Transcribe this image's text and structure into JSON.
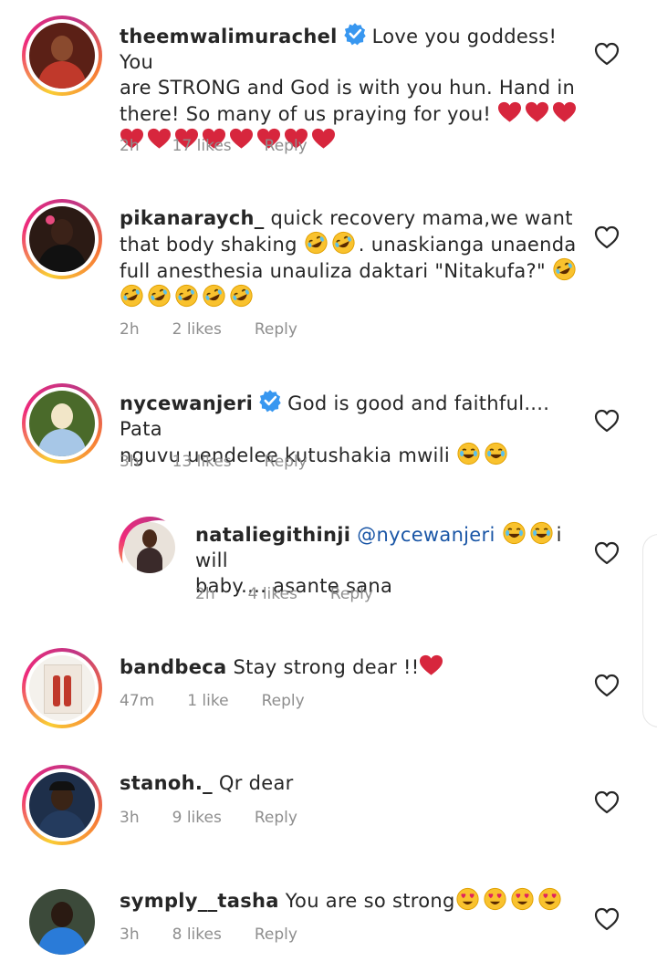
{
  "comments": [
    {
      "username": "theemwalimurachel",
      "verified": true,
      "lines": [
        "Love you goddess! You",
        "are STRONG and God is with you hun. Hand in",
        "there! So many of us praying for you!"
      ],
      "emoji_after_line3": "heart-emoji x3",
      "line4_emoji": "heart-emoji x8",
      "time": "2h",
      "likes": "17 likes",
      "reply": "Reply"
    },
    {
      "username": "pikanaraych_",
      "verified": false,
      "lines": [
        "quick recovery mama,we want",
        "that body shaking",
        ". unaskianga unaenda",
        "full anesthesia unauliza daktari \"Nitakufa?\""
      ],
      "time": "2h",
      "likes": "2 likes",
      "reply": "Reply"
    },
    {
      "username": "nycewanjeri",
      "verified": true,
      "lines": [
        "God is good and faithful.... Pata",
        "nguvu uendelee kutushakia mwili"
      ],
      "time": "3h",
      "likes": "13 likes",
      "reply": "Reply"
    },
    {
      "username": "nataliegithinji",
      "verified": false,
      "mention": "@nycewanjeri",
      "lines": [
        "i will",
        "baby.... asante sana"
      ],
      "time": "2h",
      "likes": "4 likes",
      "reply": "Reply"
    },
    {
      "username": "bandbeca",
      "verified": false,
      "lines": [
        "Stay strong dear !!"
      ],
      "time": "47m",
      "likes": "1 like",
      "reply": "Reply"
    },
    {
      "username": "stanoh._",
      "verified": false,
      "lines": [
        "Qr dear"
      ],
      "time": "3h",
      "likes": "9 likes",
      "reply": "Reply"
    },
    {
      "username": "symply__tasha",
      "verified": false,
      "lines": [
        "You are so strong"
      ],
      "time": "3h",
      "likes": "8 likes",
      "reply": "Reply"
    }
  ],
  "colors": {
    "text": "#262626",
    "meta": "#8e8e8e",
    "verified": "#3897f0",
    "mention": "#1a56a6",
    "heart_emoji": "#d7263d"
  }
}
